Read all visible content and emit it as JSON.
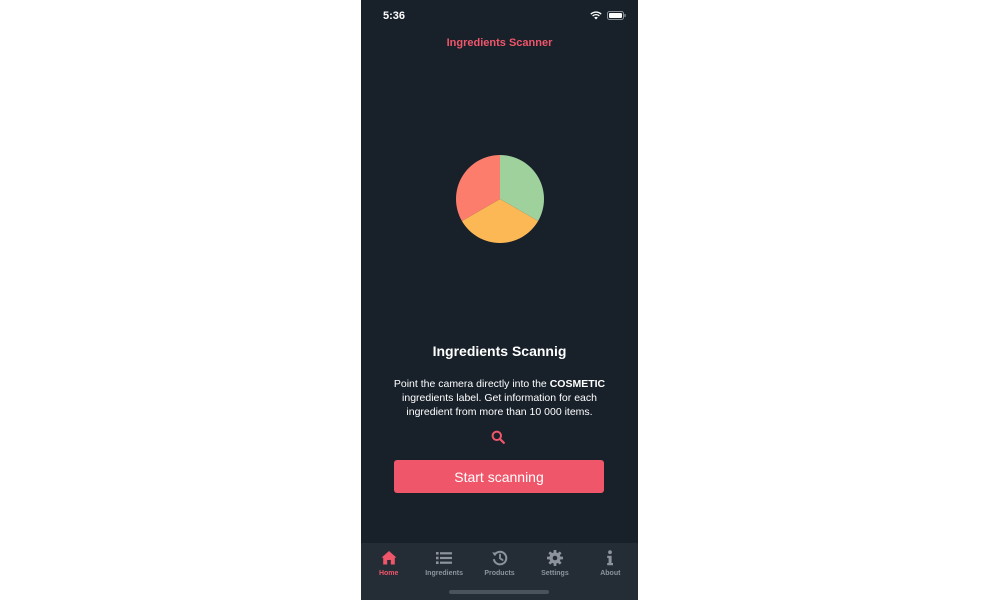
{
  "status_bar": {
    "time": "5:36",
    "icons": [
      "wifi-icon",
      "battery-icon"
    ]
  },
  "nav": {
    "title": "Ingredients Scanner"
  },
  "pie_colors": [
    "#9fd19c",
    "#fdb856",
    "#fc7d6c"
  ],
  "main": {
    "heading": "Ingredients Scannig",
    "description_before": "Point the camera directly into the ",
    "description_bold": "COSMETIC",
    "description_after": " ingredients label. Get information for each ingredient from more than 10 000 items.",
    "search_icon": "search-icon",
    "start_button_label": "Start scanning"
  },
  "tab_bar": {
    "active_color": "#f0566a",
    "inactive_color": "#8c939c",
    "items": [
      {
        "label": "Home",
        "icon": "home-icon",
        "active": true
      },
      {
        "label": "Ingredients",
        "icon": "list-icon",
        "active": false
      },
      {
        "label": "Products",
        "icon": "history-icon",
        "active": false
      },
      {
        "label": "Settings",
        "icon": "gear-icon",
        "active": false
      },
      {
        "label": "About",
        "icon": "info-icon",
        "active": false
      }
    ]
  }
}
